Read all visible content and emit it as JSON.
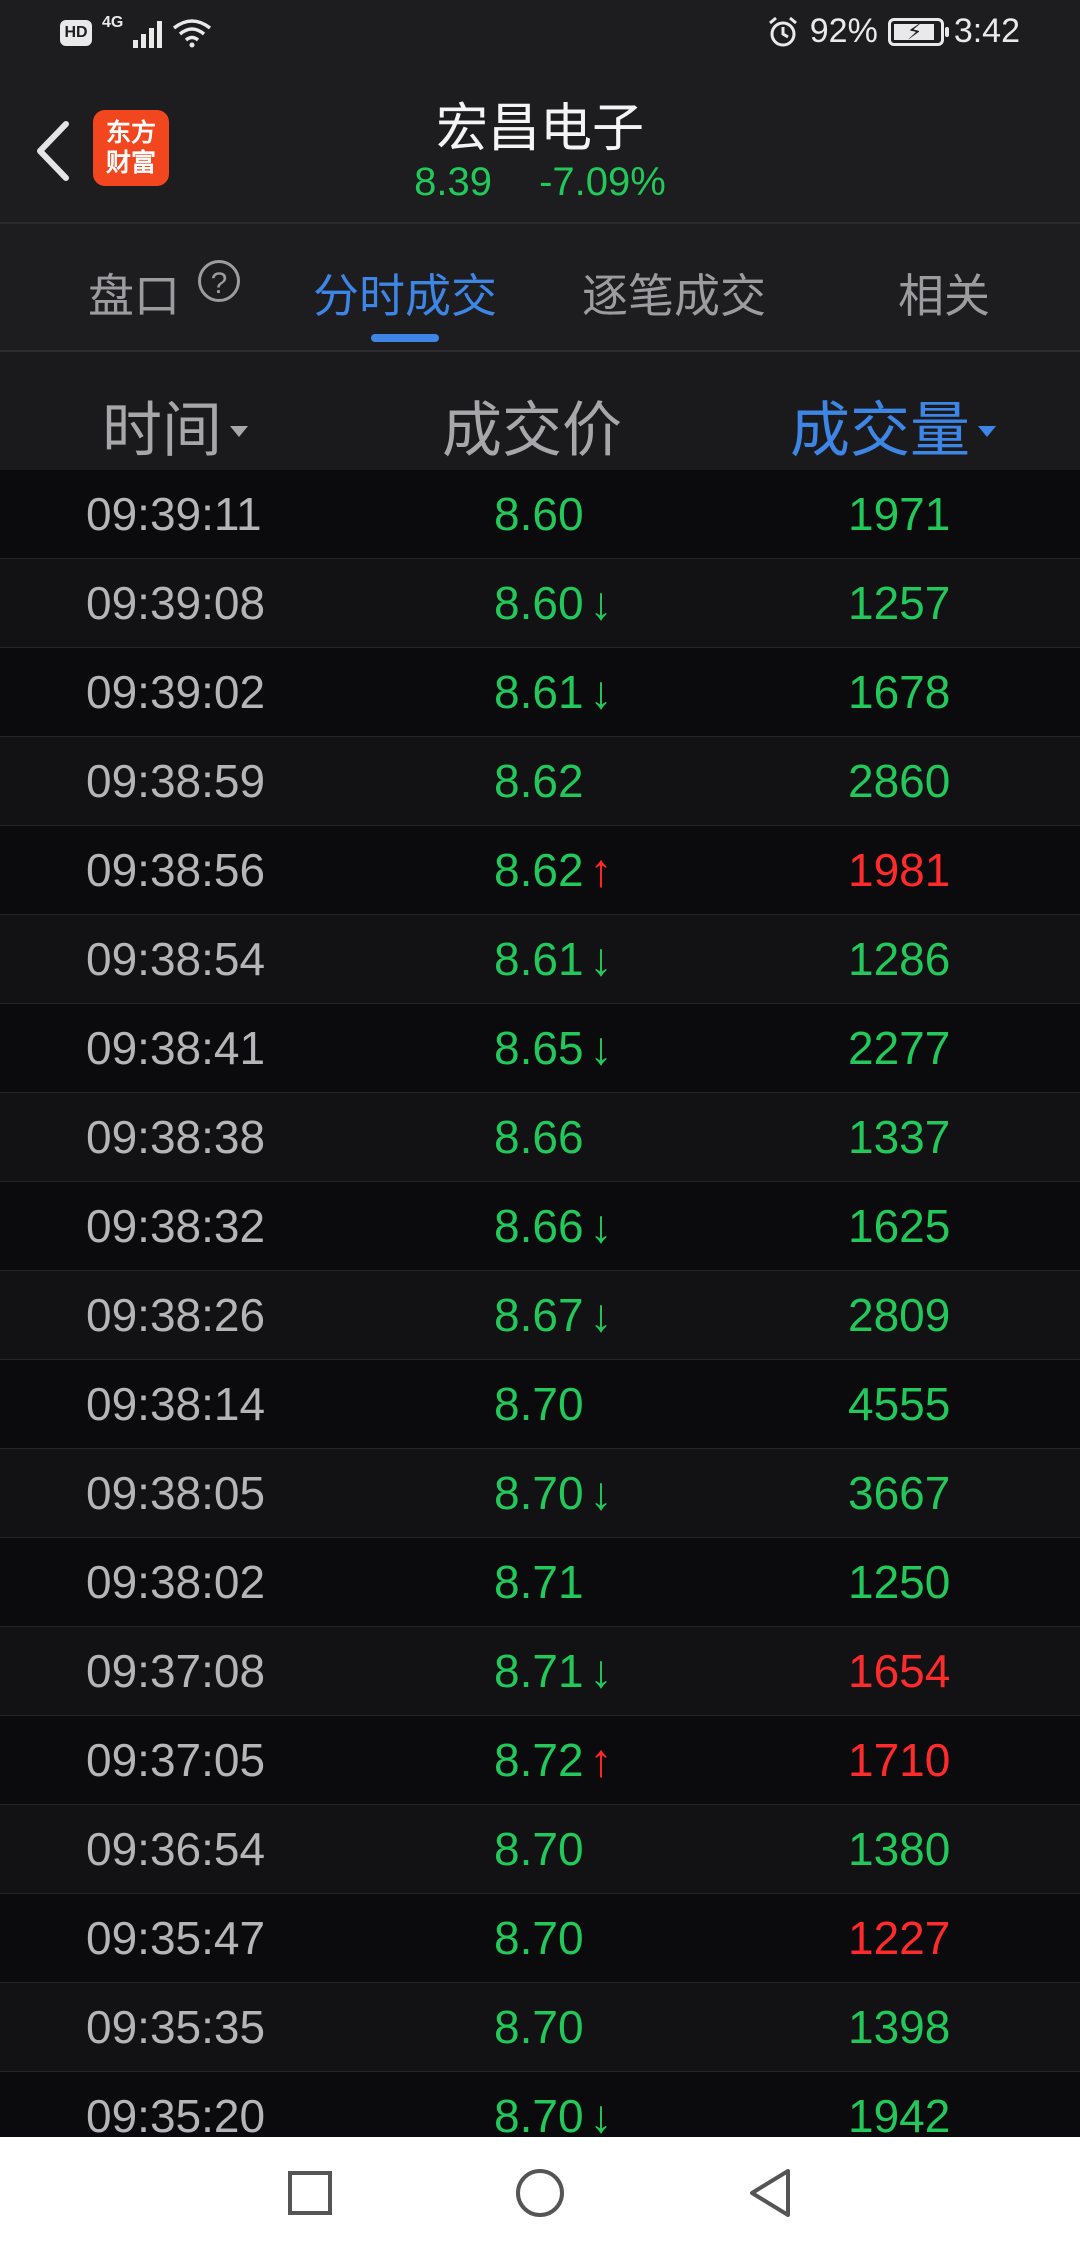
{
  "status_bar": {
    "hd": "HD",
    "network": "4G",
    "battery_percent": "92%",
    "battery_level": 0.92,
    "time": "3:42"
  },
  "header": {
    "logo_line1": "东方",
    "logo_line2": "财富",
    "stock_name": "宏昌电子",
    "price": "8.39",
    "change_percent": "-7.09%"
  },
  "tabs": [
    {
      "label": "盘口",
      "active": false
    },
    {
      "label": "分时成交",
      "active": true
    },
    {
      "label": "逐笔成交",
      "active": false
    },
    {
      "label": "相关",
      "active": false
    }
  ],
  "help_icon_text": "?",
  "columns": {
    "time": "时间",
    "price": "成交价",
    "volume": "成交量"
  },
  "trades": [
    {
      "time": "09:39:11",
      "price": "8.60",
      "dir": "",
      "volume": "1971",
      "vol_color": "green"
    },
    {
      "time": "09:39:08",
      "price": "8.60",
      "dir": "↓",
      "volume": "1257",
      "vol_color": "green"
    },
    {
      "time": "09:39:02",
      "price": "8.61",
      "dir": "↓",
      "volume": "1678",
      "vol_color": "green"
    },
    {
      "time": "09:38:59",
      "price": "8.62",
      "dir": "",
      "volume": "2860",
      "vol_color": "green"
    },
    {
      "time": "09:38:56",
      "price": "8.62",
      "dir": "↑",
      "volume": "1981",
      "vol_color": "red"
    },
    {
      "time": "09:38:54",
      "price": "8.61",
      "dir": "↓",
      "volume": "1286",
      "vol_color": "green"
    },
    {
      "time": "09:38:41",
      "price": "8.65",
      "dir": "↓",
      "volume": "2277",
      "vol_color": "green"
    },
    {
      "time": "09:38:38",
      "price": "8.66",
      "dir": "",
      "volume": "1337",
      "vol_color": "green"
    },
    {
      "time": "09:38:32",
      "price": "8.66",
      "dir": "↓",
      "volume": "1625",
      "vol_color": "green"
    },
    {
      "time": "09:38:26",
      "price": "8.67",
      "dir": "↓",
      "volume": "2809",
      "vol_color": "green"
    },
    {
      "time": "09:38:14",
      "price": "8.70",
      "dir": "",
      "volume": "4555",
      "vol_color": "green"
    },
    {
      "time": "09:38:05",
      "price": "8.70",
      "dir": "↓",
      "volume": "3667",
      "vol_color": "green"
    },
    {
      "time": "09:38:02",
      "price": "8.71",
      "dir": "",
      "volume": "1250",
      "vol_color": "green"
    },
    {
      "time": "09:37:08",
      "price": "8.71",
      "dir": "↓",
      "volume": "1654",
      "vol_color": "red"
    },
    {
      "time": "09:37:05",
      "price": "8.72",
      "dir": "↑",
      "volume": "1710",
      "vol_color": "red"
    },
    {
      "time": "09:36:54",
      "price": "8.70",
      "dir": "",
      "volume": "1380",
      "vol_color": "green"
    },
    {
      "time": "09:35:47",
      "price": "8.70",
      "dir": "",
      "volume": "1227",
      "vol_color": "red"
    },
    {
      "time": "09:35:35",
      "price": "8.70",
      "dir": "",
      "volume": "1398",
      "vol_color": "green"
    },
    {
      "time": "09:35:20",
      "price": "8.70",
      "dir": "↓",
      "volume": "1942",
      "vol_color": "green"
    }
  ],
  "colors": {
    "up": "#ff2a2a",
    "down": "#22c85a",
    "accent": "#3d86e6",
    "logo": "#f2461f"
  },
  "icons": {
    "back": "chevron-left-icon",
    "help": "question-circle-icon",
    "nav_recent": "square-icon",
    "nav_home": "circle-icon",
    "nav_back": "triangle-left-icon"
  }
}
